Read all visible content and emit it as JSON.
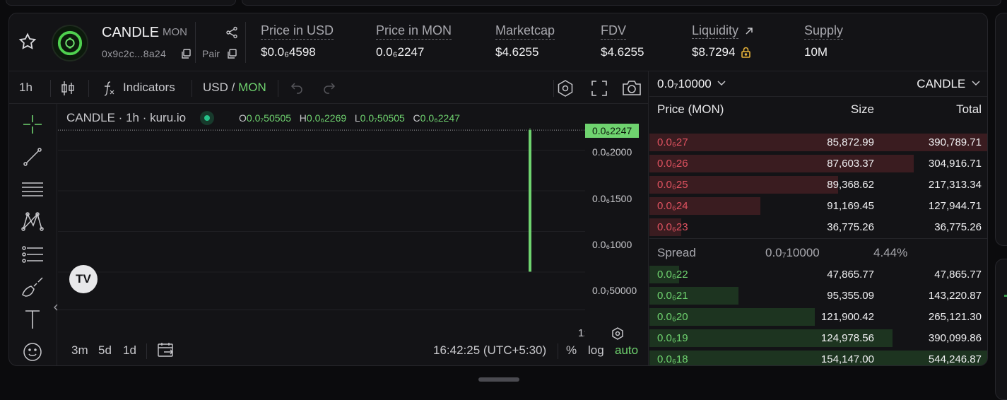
{
  "header": {
    "token_name": "CANDLE",
    "quote": "MON",
    "address": "0x9c2c...8a24",
    "pair_label": "Pair",
    "stats": [
      {
        "label": "Price in USD",
        "value": "$0.0₆4598"
      },
      {
        "label": "Price in MON",
        "value": "0.0₆2247"
      },
      {
        "label": "Marketcap",
        "value": "$4.6255"
      },
      {
        "label": "FDV",
        "value": "$4.6255"
      },
      {
        "label": "Liquidity",
        "value": "$8.7294"
      },
      {
        "label": "Supply",
        "value": "10M"
      }
    ]
  },
  "toolbar": {
    "interval": "1h",
    "indicators": "Indicators",
    "currency_usd": "USD",
    "currency_sep": "/",
    "currency_mon": "MON"
  },
  "chart": {
    "legend_title": "CANDLE · 1h · kuru.io",
    "ohlc": {
      "o_label": "O",
      "o": "0.0₇50505",
      "h_label": "H",
      "h": "0.0₆2269",
      "l_label": "L",
      "l": "0.0₇50505",
      "c_label": "C",
      "c": "0.0₆2247"
    },
    "current_price": "0.0₆2247",
    "y_ticks": [
      "0.0₆2000",
      "0.0₆1500",
      "0.0₆1000",
      "0.0₇50000"
    ],
    "x_tick_partial": "1:",
    "tv_logo": "TV"
  },
  "chart_data": {
    "type": "bar",
    "categories": [
      "1h"
    ],
    "values": [
      2.247e-07
    ],
    "ohlc": {
      "open": 5.0505e-08,
      "high": 2.269e-07,
      "low": 5.0505e-08,
      "close": 2.247e-07
    },
    "ylim": [
      3e-08,
      2.3e-07
    ],
    "y_tick_values": [
      2e-07,
      1.5e-07,
      1e-07,
      5e-08
    ]
  },
  "bottom_bar": {
    "ranges": [
      "3m",
      "5d",
      "1d"
    ],
    "time": "16:42:25 (UTC+5:30)",
    "percent": "%",
    "log": "log",
    "auto": "auto"
  },
  "orderbook": {
    "tick_size": "0.0₇10000",
    "symbol": "CANDLE",
    "headers": {
      "price": "Price (MON)",
      "size": "Size",
      "total": "Total"
    },
    "asks": [
      {
        "price": "0.0₆27",
        "size": "85,872.99",
        "total": "390,789.71",
        "depth": 1.0
      },
      {
        "price": "0.0₆26",
        "size": "87,603.37",
        "total": "304,916.71",
        "depth": 0.78
      },
      {
        "price": "0.0₆25",
        "size": "89,368.62",
        "total": "217,313.34",
        "depth": 0.556
      },
      {
        "price": "0.0₆24",
        "size": "91,169.45",
        "total": "127,944.71",
        "depth": 0.327
      },
      {
        "price": "0.0₆23",
        "size": "36,775.26",
        "total": "36,775.26",
        "depth": 0.094
      }
    ],
    "spread_label": "Spread",
    "spread_value": "0.0₇10000",
    "spread_pct": "4.44%",
    "bids": [
      {
        "price": "0.0₆22",
        "size": "47,865.77",
        "total": "47,865.77",
        "depth": 0.088
      },
      {
        "price": "0.0₆21",
        "size": "95,355.09",
        "total": "143,220.87",
        "depth": 0.263
      },
      {
        "price": "0.0₆20",
        "size": "121,900.42",
        "total": "265,121.30",
        "depth": 0.487
      },
      {
        "price": "0.0₆19",
        "size": "124,978.56",
        "total": "390,099.86",
        "depth": 0.717
      },
      {
        "price": "0.0₆18",
        "size": "154,147.00",
        "total": "544,246.87",
        "depth": 1.0
      }
    ]
  },
  "colors": {
    "accent_green": "#6fd36f",
    "ask_red": "#e05260",
    "ask_bar": "#3a1c20",
    "bid_bar": "#1d3420",
    "lock_gold": "#e6b23a"
  },
  "icons": [
    "star-icon",
    "candle-logo",
    "copy-icon",
    "share-icon",
    "lock-icon",
    "arrow-up-right-icon",
    "candle-type-icon",
    "function-icon",
    "undo-icon",
    "redo-icon",
    "settings-hex-icon",
    "fullscreen-icon",
    "camera-icon",
    "crosshair-icon",
    "trend-line-icon",
    "fib-icon",
    "pattern-icon",
    "prediction-icon",
    "brush-icon",
    "text-icon",
    "emoji-icon",
    "calendar-range-icon",
    "chevron-down-icon"
  ]
}
